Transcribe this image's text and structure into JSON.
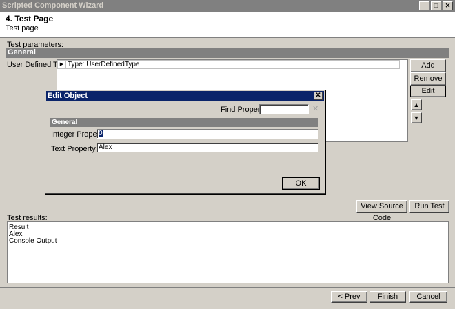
{
  "window": {
    "title": "Scripted Component Wizard",
    "min": "_",
    "max": "□",
    "close": "✕"
  },
  "header": {
    "title": "4. Test Page",
    "subtitle": "Test page"
  },
  "params": {
    "label": "Test parameters:",
    "section": "General",
    "property_label": "User Defined Type",
    "list_item": "Type: UserDefinedType",
    "row_arrow": "▶",
    "buttons": {
      "add": "Add",
      "remove": "Remove",
      "edit": "Edit",
      "up": "▲",
      "down": "▼"
    }
  },
  "dialog": {
    "title": "Edit Object",
    "close": "✕",
    "find_label": "Find Properties",
    "find_value": "",
    "find_clear": "✕",
    "section": "General",
    "rows": [
      {
        "label": "Integer Property",
        "value": "0"
      },
      {
        "label": "Text Property",
        "value": "Alex"
      }
    ],
    "ok": "OK"
  },
  "actions": {
    "view_source": "View Source Code",
    "run_test": "Run Test"
  },
  "results": {
    "label": "Test results:",
    "lines": [
      "Result",
      "Alex",
      "Console Output"
    ]
  },
  "nav": {
    "prev": "< Prev",
    "finish": "Finish",
    "cancel": "Cancel"
  }
}
